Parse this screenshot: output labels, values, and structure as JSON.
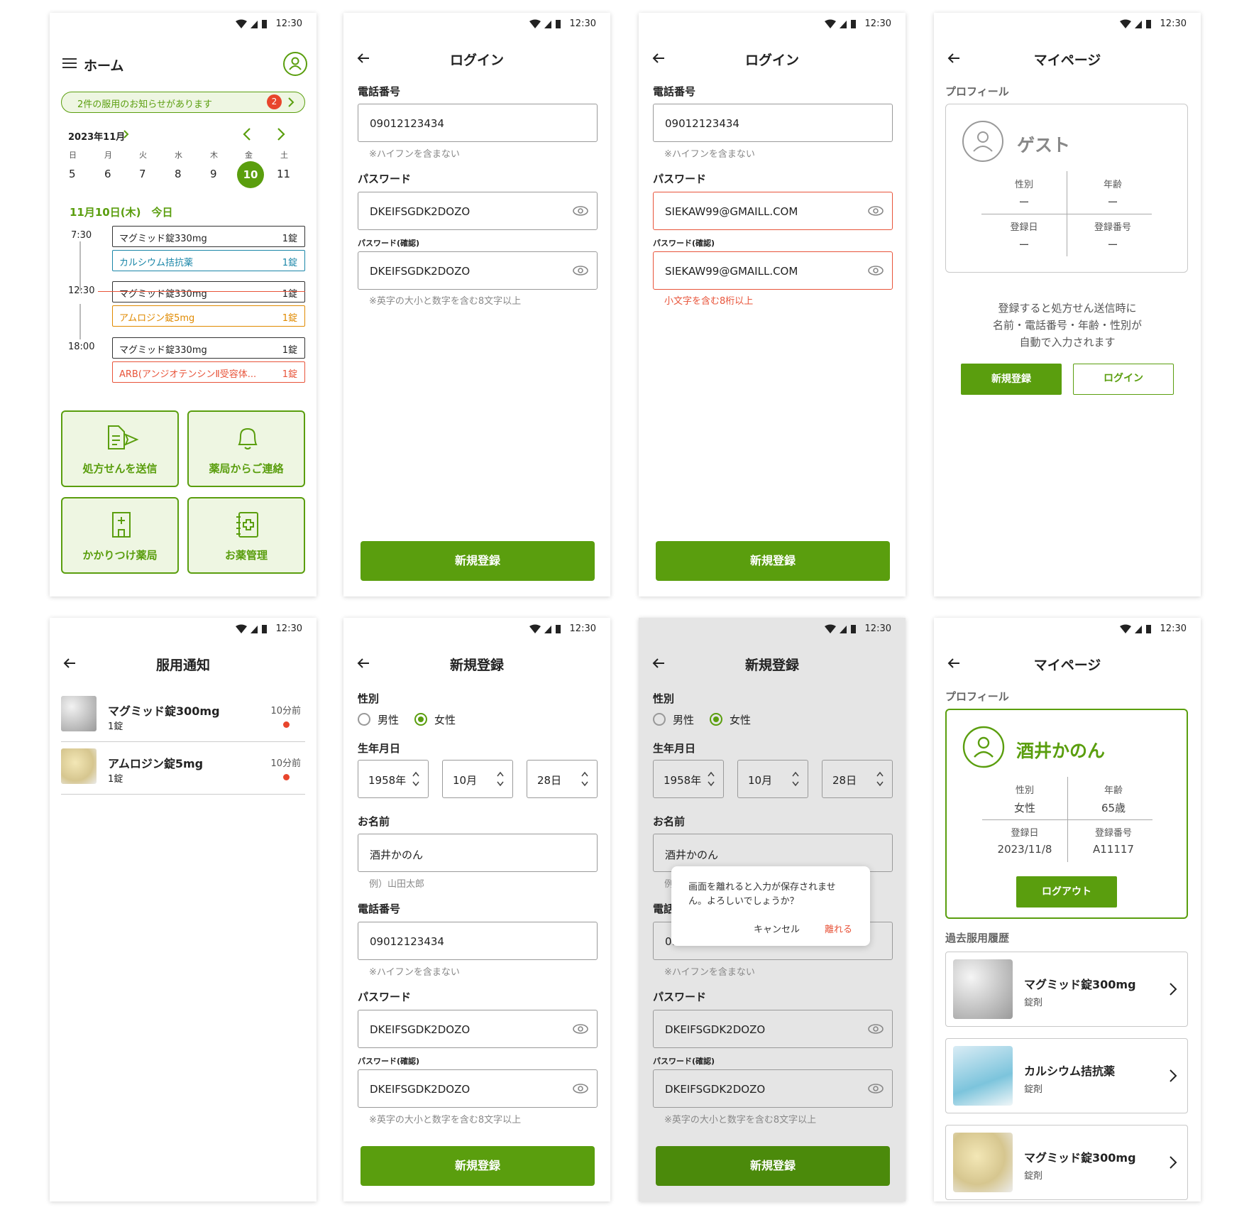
{
  "status": {
    "time": "12:30"
  },
  "home": {
    "title": "ホーム",
    "notice": "2件の服用のお知らせがあります",
    "notice_count": "2",
    "month": "2023年11月",
    "weekdays": [
      "日",
      "月",
      "火",
      "水",
      "木",
      "金",
      "土"
    ],
    "days": [
      "5",
      "6",
      "7",
      "8",
      "9",
      "10",
      "11"
    ],
    "today_label": "11月10日(木)　今日",
    "times": [
      "7:30",
      "12:30",
      "18:00"
    ],
    "meds": [
      {
        "name": "マグミッド錠330mg",
        "qty": "1錠",
        "color": "#333333"
      },
      {
        "name": "カルシウム拮抗薬",
        "qty": "1錠",
        "color": "#1a86a8"
      },
      {
        "name": "マグミッド錠330mg",
        "qty": "1錠",
        "color": "#333333"
      },
      {
        "name": "アムロジン錠5mg",
        "qty": "1錠",
        "color": "#e08a00"
      },
      {
        "name": "マグミッド錠330mg",
        "qty": "1錠",
        "color": "#333333"
      },
      {
        "name": "ARB(アンジオテンシンⅡ受容体...",
        "qty": "1錠",
        "color": "#e8543a"
      }
    ],
    "tiles": [
      "処方せんを送信",
      "薬局からご連絡",
      "かかりつけ薬局",
      "お薬管理"
    ]
  },
  "login": {
    "title": "ログイン",
    "phone_label": "電話番号",
    "phone_value": "09012123434",
    "phone_hint": "※ハイフンを含まない",
    "pw_label": "パスワード",
    "pw_value": "DKEIFSGDK2DOZO",
    "pw_confirm_label": "パスワード(確認)",
    "pw_hint": "※英字の大小と数字を含む8文字以上",
    "button": "新規登録"
  },
  "login_error": {
    "pw_value": "SIEKAW99@GMAILL.COM",
    "error": "小文字を含む8桁以上"
  },
  "mypage_guest": {
    "title": "マイページ",
    "section": "プロフィール",
    "name": "ゲスト",
    "fields": {
      "gender": "性別",
      "age": "年齢",
      "reg_date": "登録日",
      "reg_no": "登録番号"
    },
    "empty": "ー",
    "message": [
      "登録すると処方せん送信時に",
      "名前・電話番号・年齢・性別が",
      "自動で入力されます"
    ],
    "register": "新規登録",
    "login": "ログイン"
  },
  "notify": {
    "title": "服用通知",
    "items": [
      {
        "name": "マグミッド錠300mg",
        "qty": "1錠",
        "time": "10分前"
      },
      {
        "name": "アムロジン錠5mg",
        "qty": "1錠",
        "time": "10分前"
      }
    ]
  },
  "register": {
    "title": "新規登録",
    "gender_label": "性別",
    "male": "男性",
    "female": "女性",
    "birth_label": "生年月日",
    "year": "1958年",
    "month": "10月",
    "day": "28日",
    "name_label": "お名前",
    "name_value": "酒井かのん",
    "name_hint": "例）山田太郎",
    "phone_label": "電話番号",
    "phone_partial": "09",
    "label_partial_phone": "電話",
    "name_hint_partial": "例"
  },
  "dialog": {
    "message_1": "画面を離れると入力が保存されませ",
    "message_2": "ん。よろしいでしょうか？",
    "cancel": "キャンセル",
    "leave": "離れる"
  },
  "mypage_user": {
    "name": "酒井かのん",
    "gender": "女性",
    "age": "65歳",
    "reg_date": "2023/11/8",
    "reg_no": "A11117",
    "logout": "ログアウト",
    "history_label": "過去服用履歴",
    "history": [
      {
        "name": "マグミッド錠300mg",
        "type": "錠剤"
      },
      {
        "name": "カルシウム拮抗薬",
        "type": "錠剤"
      },
      {
        "name": "マグミッド錠300mg",
        "type": "錠剤"
      }
    ]
  },
  "colors": {
    "accent": "#5a9e0e",
    "error": "#e8543a",
    "badge": "#e8452c"
  },
  "icons": [
    "menu-icon",
    "user-icon",
    "chevron-right-icon",
    "chevron-left-icon",
    "back-arrow-icon",
    "eye-icon",
    "document-send-icon",
    "bell-icon",
    "pharmacy-icon",
    "medicine-book-icon",
    "wifi-icon",
    "signal-icon",
    "battery-icon"
  ]
}
